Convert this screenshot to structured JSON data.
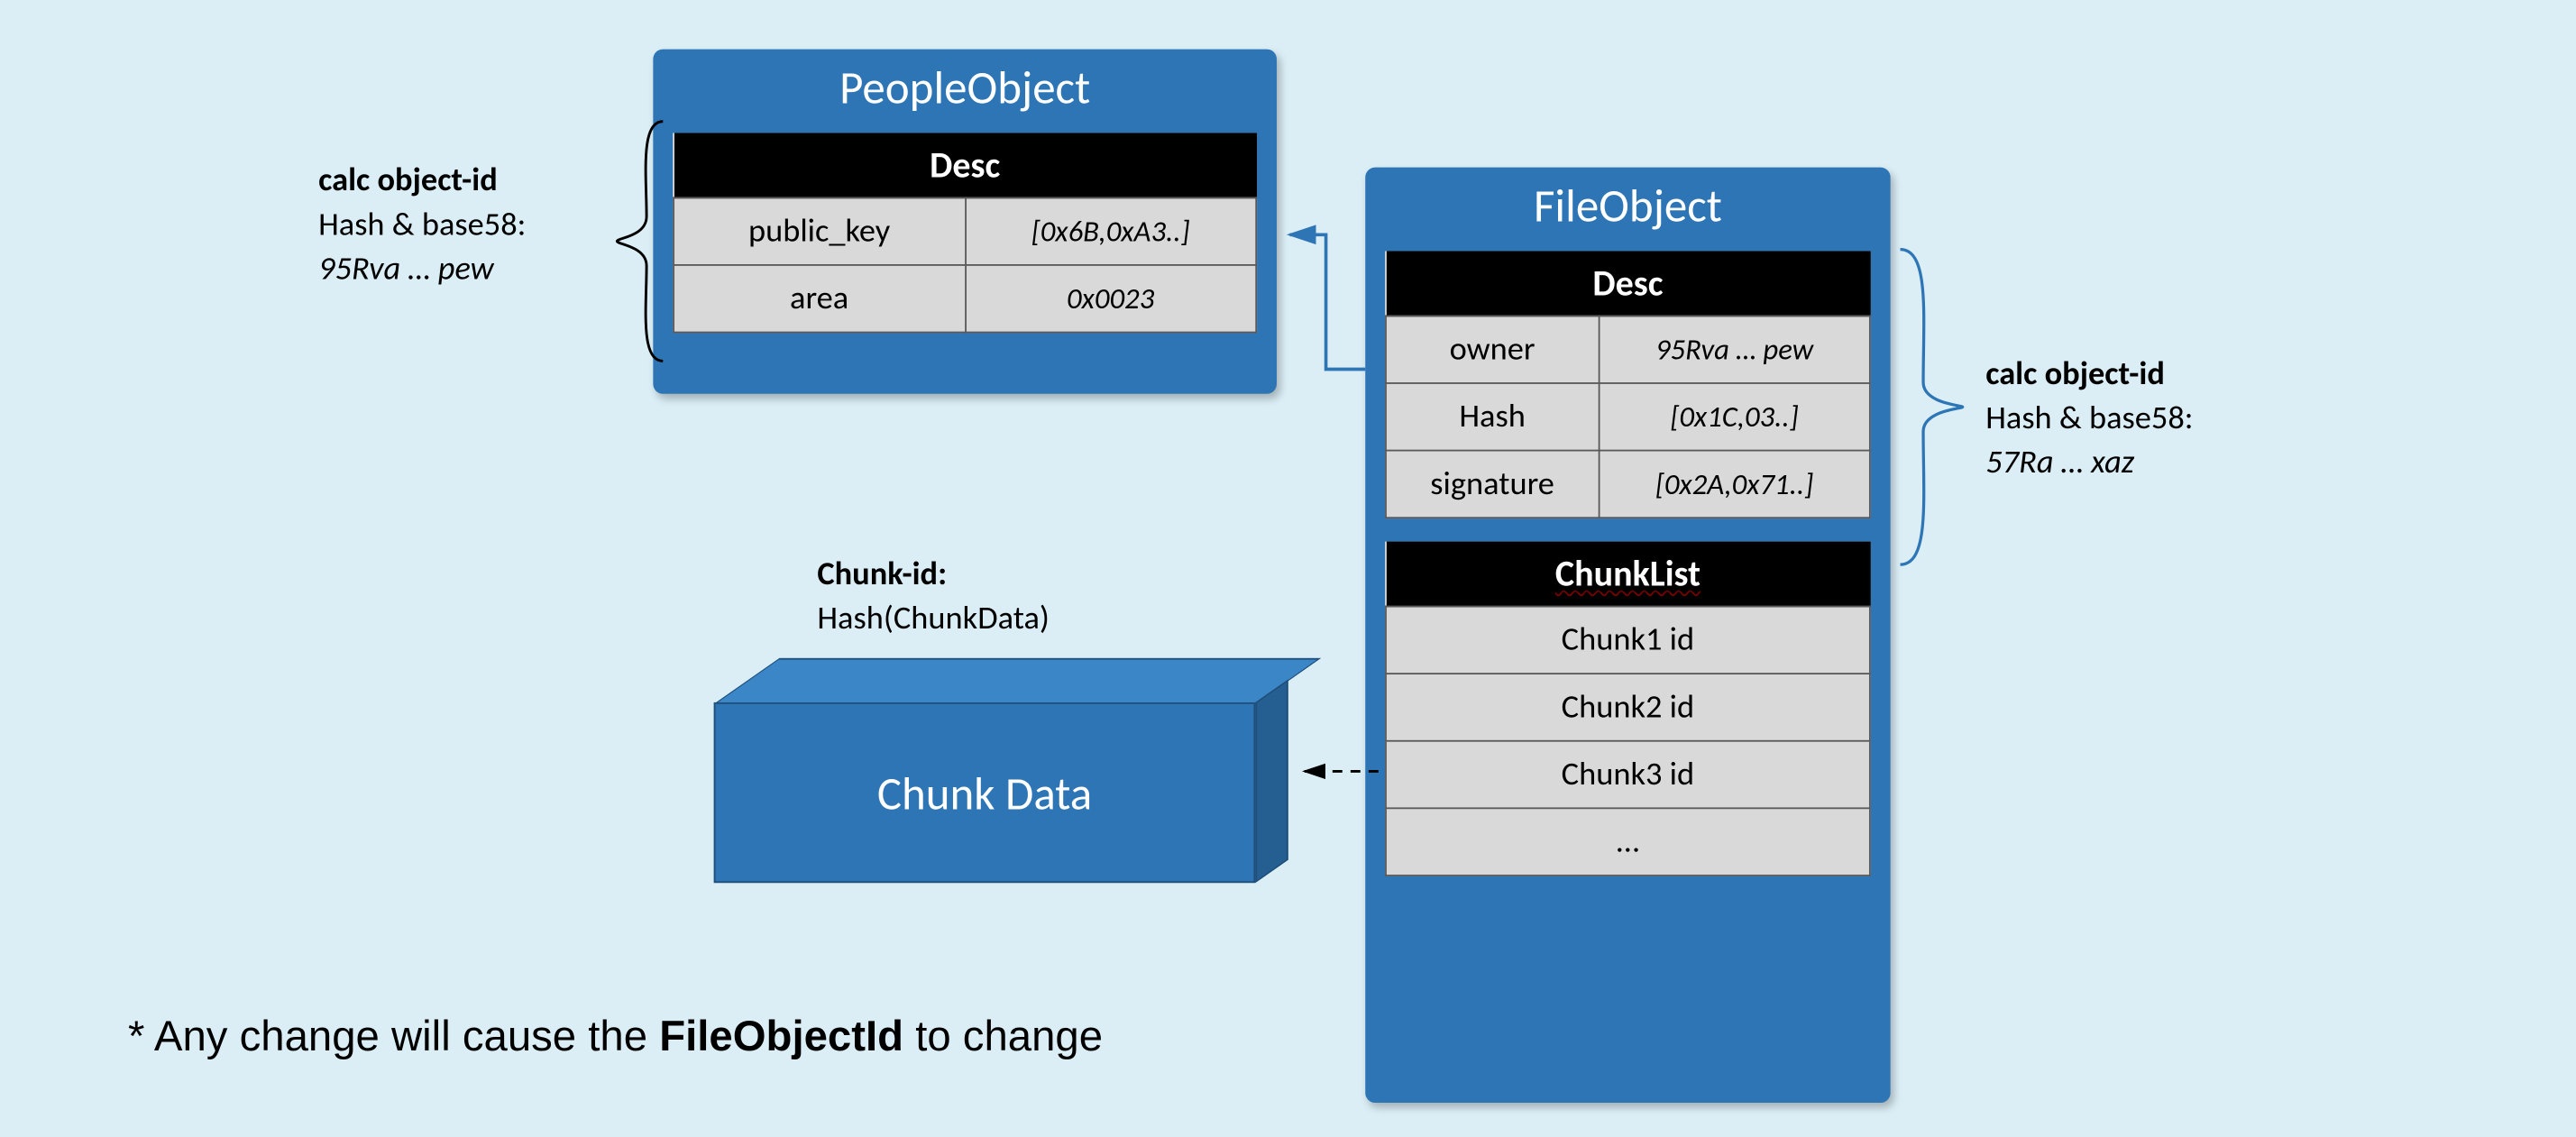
{
  "people": {
    "title": "PeopleObject",
    "desc_header": "Desc",
    "rows": [
      {
        "k": "public_key",
        "v": "[0x6B,0xA3..]"
      },
      {
        "k": "area",
        "v": "0x0023"
      }
    ]
  },
  "file": {
    "title": "FileObject",
    "desc_header": "Desc",
    "rows": [
      {
        "k": "owner",
        "v": "95Rva … pew"
      },
      {
        "k": "Hash",
        "v": "[0x1C,03..]"
      },
      {
        "k": "signature",
        "v": "[0x2A,0x71..]"
      }
    ],
    "chunklist_header": "ChunkList",
    "chunks": [
      "Chunk1 id",
      "Chunk2 id",
      "Chunk3 id",
      "…"
    ]
  },
  "chunk_block": {
    "label": "Chunk Data",
    "id_title": "Chunk-id:",
    "id_sub": "Hash(ChunkData)"
  },
  "annot_left": {
    "l1": "calc object-id",
    "l2": "Hash & base58:",
    "l3": "95Rva … pew"
  },
  "annot_right": {
    "l1": "calc object-id",
    "l2": "Hash & base58:",
    "l3": "57Ra … xaz"
  },
  "footnote": {
    "prefix": "* Any change will cause the ",
    "strong": "FileObjectId",
    "suffix": " to change"
  }
}
